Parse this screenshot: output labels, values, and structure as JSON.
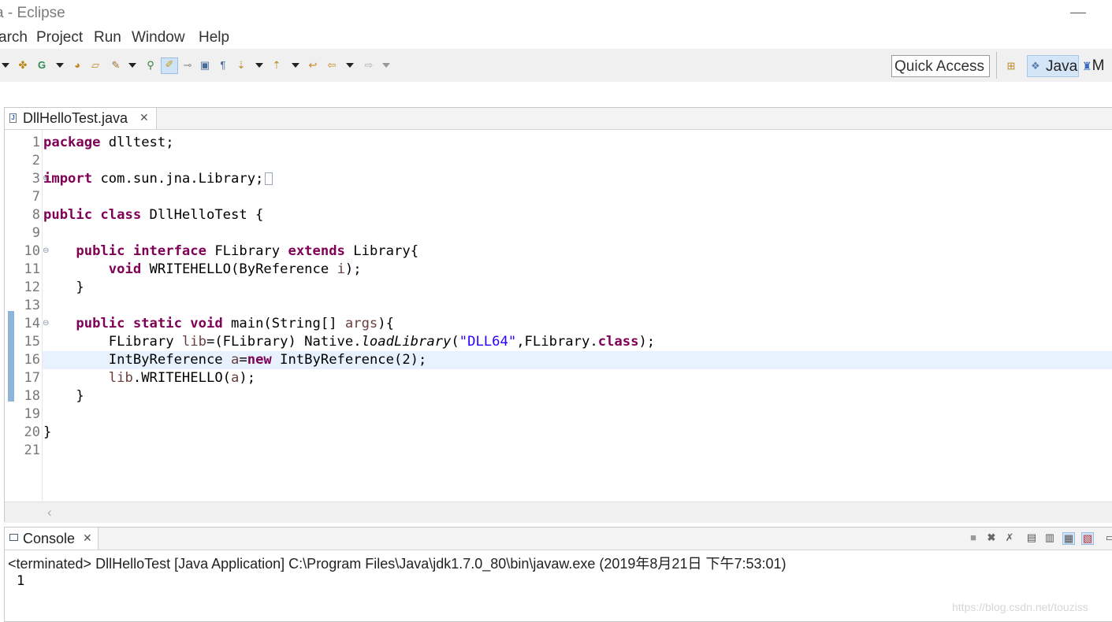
{
  "window": {
    "title": "a - Eclipse"
  },
  "menu": {
    "items": [
      "arch",
      "Project",
      "Run",
      "Window",
      "Help"
    ]
  },
  "toolbar": {
    "icons": [
      "dropdown-arrow",
      "new-icon",
      "run-icon",
      "open-type-icon",
      "open-folder-icon",
      "brush-icon",
      "search-icon",
      "toggle-mark-icon",
      "highlight-icon",
      "show-whitespace-icon",
      "block-selection-icon",
      "pilcrow-icon",
      "next-annotation-icon",
      "prev-annotation-icon",
      "last-edit-icon",
      "back-icon",
      "forward-icon"
    ],
    "quick_access": "Quick Access",
    "perspectives": [
      "Java",
      "M"
    ]
  },
  "editor": {
    "tab_label": "DllHelloTest.java",
    "current_line": 16,
    "lines": [
      {
        "n": "1",
        "parts": [
          [
            "kw",
            "package"
          ],
          [
            "",
            "dlltest;"
          ]
        ]
      },
      {
        "n": "2",
        "parts": []
      },
      {
        "n": "3",
        "parts": [
          [
            "kw",
            "import"
          ],
          [
            "",
            "com.sun.jna.Library;"
          ]
        ]
      },
      {
        "n": "7",
        "parts": []
      },
      {
        "n": "8",
        "parts": [
          [
            "kw",
            "public class"
          ],
          [
            "",
            "DllHelloTest {"
          ]
        ]
      },
      {
        "n": "9",
        "parts": []
      },
      {
        "n": "10",
        "parts": [
          [
            "",
            "    "
          ],
          [
            "kw",
            "public interface"
          ],
          [
            "",
            " FLibrary "
          ],
          [
            "kw",
            "extends"
          ],
          [
            "",
            " Library{"
          ]
        ]
      },
      {
        "n": "11",
        "parts": [
          [
            "",
            "        "
          ],
          [
            "kw",
            "void"
          ],
          [
            "",
            " WRITEHELLO(ByReference "
          ],
          [
            "fld",
            "i"
          ],
          [
            "",
            ");"
          ]
        ]
      },
      {
        "n": "12",
        "parts": [
          [
            "",
            "    }"
          ]
        ]
      },
      {
        "n": "13",
        "parts": []
      },
      {
        "n": "14",
        "parts": [
          [
            "",
            "    "
          ],
          [
            "kw",
            "public static void"
          ],
          [
            "",
            " main(String[] "
          ],
          [
            "fld",
            "args"
          ],
          [
            "",
            "){"
          ]
        ]
      },
      {
        "n": "15",
        "parts": [
          [
            "",
            "        FLibrary "
          ],
          [
            "fld",
            "lib"
          ],
          [
            "",
            "=(FLibrary) Native."
          ],
          [
            "it",
            "loadLibrary"
          ],
          [
            "",
            "("
          ],
          [
            "str",
            "\"DLL64\""
          ],
          [
            "",
            ",FLibrary."
          ],
          [
            "kw",
            "class"
          ],
          [
            "",
            ");"
          ]
        ]
      },
      {
        "n": "16",
        "parts": [
          [
            "",
            "        IntByReference "
          ],
          [
            "fld",
            "a"
          ],
          [
            "",
            "="
          ],
          [
            "kw",
            "new"
          ],
          [
            "",
            " IntByReference(2);"
          ]
        ]
      },
      {
        "n": "17",
        "parts": [
          [
            "",
            "        "
          ],
          [
            "fld",
            "lib"
          ],
          [
            "",
            ".WRITEHELLO("
          ],
          [
            "fld",
            "a"
          ],
          [
            "",
            ");"
          ]
        ]
      },
      {
        "n": "18",
        "parts": [
          [
            "",
            "    }"
          ]
        ]
      },
      {
        "n": "19",
        "parts": []
      },
      {
        "n": "20",
        "parts": [
          [
            "",
            "}"
          ]
        ]
      },
      {
        "n": "21",
        "parts": []
      }
    ]
  },
  "console": {
    "tab_label": "Console",
    "status": "<terminated> DllHelloTest [Java Application] C:\\Program Files\\Java\\jdk1.7.0_80\\bin\\javaw.exe (2019年8月21日 下午7:53:01)",
    "output": "1"
  },
  "watermark": "https://blog.csdn.net/touziss"
}
